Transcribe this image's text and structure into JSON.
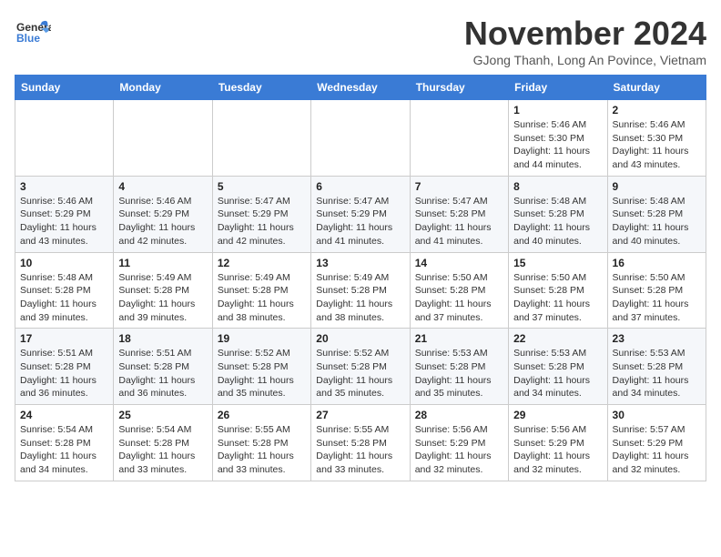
{
  "logo": {
    "general": "General",
    "blue": "Blue"
  },
  "title": "November 2024",
  "subtitle": "GJong Thanh, Long An Povince, Vietnam",
  "days_of_week": [
    "Sunday",
    "Monday",
    "Tuesday",
    "Wednesday",
    "Thursday",
    "Friday",
    "Saturday"
  ],
  "weeks": [
    [
      {
        "day": "",
        "info": ""
      },
      {
        "day": "",
        "info": ""
      },
      {
        "day": "",
        "info": ""
      },
      {
        "day": "",
        "info": ""
      },
      {
        "day": "",
        "info": ""
      },
      {
        "day": "1",
        "info": "Sunrise: 5:46 AM\nSunset: 5:30 PM\nDaylight: 11 hours and 44 minutes."
      },
      {
        "day": "2",
        "info": "Sunrise: 5:46 AM\nSunset: 5:30 PM\nDaylight: 11 hours and 43 minutes."
      }
    ],
    [
      {
        "day": "3",
        "info": "Sunrise: 5:46 AM\nSunset: 5:29 PM\nDaylight: 11 hours and 43 minutes."
      },
      {
        "day": "4",
        "info": "Sunrise: 5:46 AM\nSunset: 5:29 PM\nDaylight: 11 hours and 42 minutes."
      },
      {
        "day": "5",
        "info": "Sunrise: 5:47 AM\nSunset: 5:29 PM\nDaylight: 11 hours and 42 minutes."
      },
      {
        "day": "6",
        "info": "Sunrise: 5:47 AM\nSunset: 5:29 PM\nDaylight: 11 hours and 41 minutes."
      },
      {
        "day": "7",
        "info": "Sunrise: 5:47 AM\nSunset: 5:28 PM\nDaylight: 11 hours and 41 minutes."
      },
      {
        "day": "8",
        "info": "Sunrise: 5:48 AM\nSunset: 5:28 PM\nDaylight: 11 hours and 40 minutes."
      },
      {
        "day": "9",
        "info": "Sunrise: 5:48 AM\nSunset: 5:28 PM\nDaylight: 11 hours and 40 minutes."
      }
    ],
    [
      {
        "day": "10",
        "info": "Sunrise: 5:48 AM\nSunset: 5:28 PM\nDaylight: 11 hours and 39 minutes."
      },
      {
        "day": "11",
        "info": "Sunrise: 5:49 AM\nSunset: 5:28 PM\nDaylight: 11 hours and 39 minutes."
      },
      {
        "day": "12",
        "info": "Sunrise: 5:49 AM\nSunset: 5:28 PM\nDaylight: 11 hours and 38 minutes."
      },
      {
        "day": "13",
        "info": "Sunrise: 5:49 AM\nSunset: 5:28 PM\nDaylight: 11 hours and 38 minutes."
      },
      {
        "day": "14",
        "info": "Sunrise: 5:50 AM\nSunset: 5:28 PM\nDaylight: 11 hours and 37 minutes."
      },
      {
        "day": "15",
        "info": "Sunrise: 5:50 AM\nSunset: 5:28 PM\nDaylight: 11 hours and 37 minutes."
      },
      {
        "day": "16",
        "info": "Sunrise: 5:50 AM\nSunset: 5:28 PM\nDaylight: 11 hours and 37 minutes."
      }
    ],
    [
      {
        "day": "17",
        "info": "Sunrise: 5:51 AM\nSunset: 5:28 PM\nDaylight: 11 hours and 36 minutes."
      },
      {
        "day": "18",
        "info": "Sunrise: 5:51 AM\nSunset: 5:28 PM\nDaylight: 11 hours and 36 minutes."
      },
      {
        "day": "19",
        "info": "Sunrise: 5:52 AM\nSunset: 5:28 PM\nDaylight: 11 hours and 35 minutes."
      },
      {
        "day": "20",
        "info": "Sunrise: 5:52 AM\nSunset: 5:28 PM\nDaylight: 11 hours and 35 minutes."
      },
      {
        "day": "21",
        "info": "Sunrise: 5:53 AM\nSunset: 5:28 PM\nDaylight: 11 hours and 35 minutes."
      },
      {
        "day": "22",
        "info": "Sunrise: 5:53 AM\nSunset: 5:28 PM\nDaylight: 11 hours and 34 minutes."
      },
      {
        "day": "23",
        "info": "Sunrise: 5:53 AM\nSunset: 5:28 PM\nDaylight: 11 hours and 34 minutes."
      }
    ],
    [
      {
        "day": "24",
        "info": "Sunrise: 5:54 AM\nSunset: 5:28 PM\nDaylight: 11 hours and 34 minutes."
      },
      {
        "day": "25",
        "info": "Sunrise: 5:54 AM\nSunset: 5:28 PM\nDaylight: 11 hours and 33 minutes."
      },
      {
        "day": "26",
        "info": "Sunrise: 5:55 AM\nSunset: 5:28 PM\nDaylight: 11 hours and 33 minutes."
      },
      {
        "day": "27",
        "info": "Sunrise: 5:55 AM\nSunset: 5:28 PM\nDaylight: 11 hours and 33 minutes."
      },
      {
        "day": "28",
        "info": "Sunrise: 5:56 AM\nSunset: 5:29 PM\nDaylight: 11 hours and 32 minutes."
      },
      {
        "day": "29",
        "info": "Sunrise: 5:56 AM\nSunset: 5:29 PM\nDaylight: 11 hours and 32 minutes."
      },
      {
        "day": "30",
        "info": "Sunrise: 5:57 AM\nSunset: 5:29 PM\nDaylight: 11 hours and 32 minutes."
      }
    ]
  ]
}
